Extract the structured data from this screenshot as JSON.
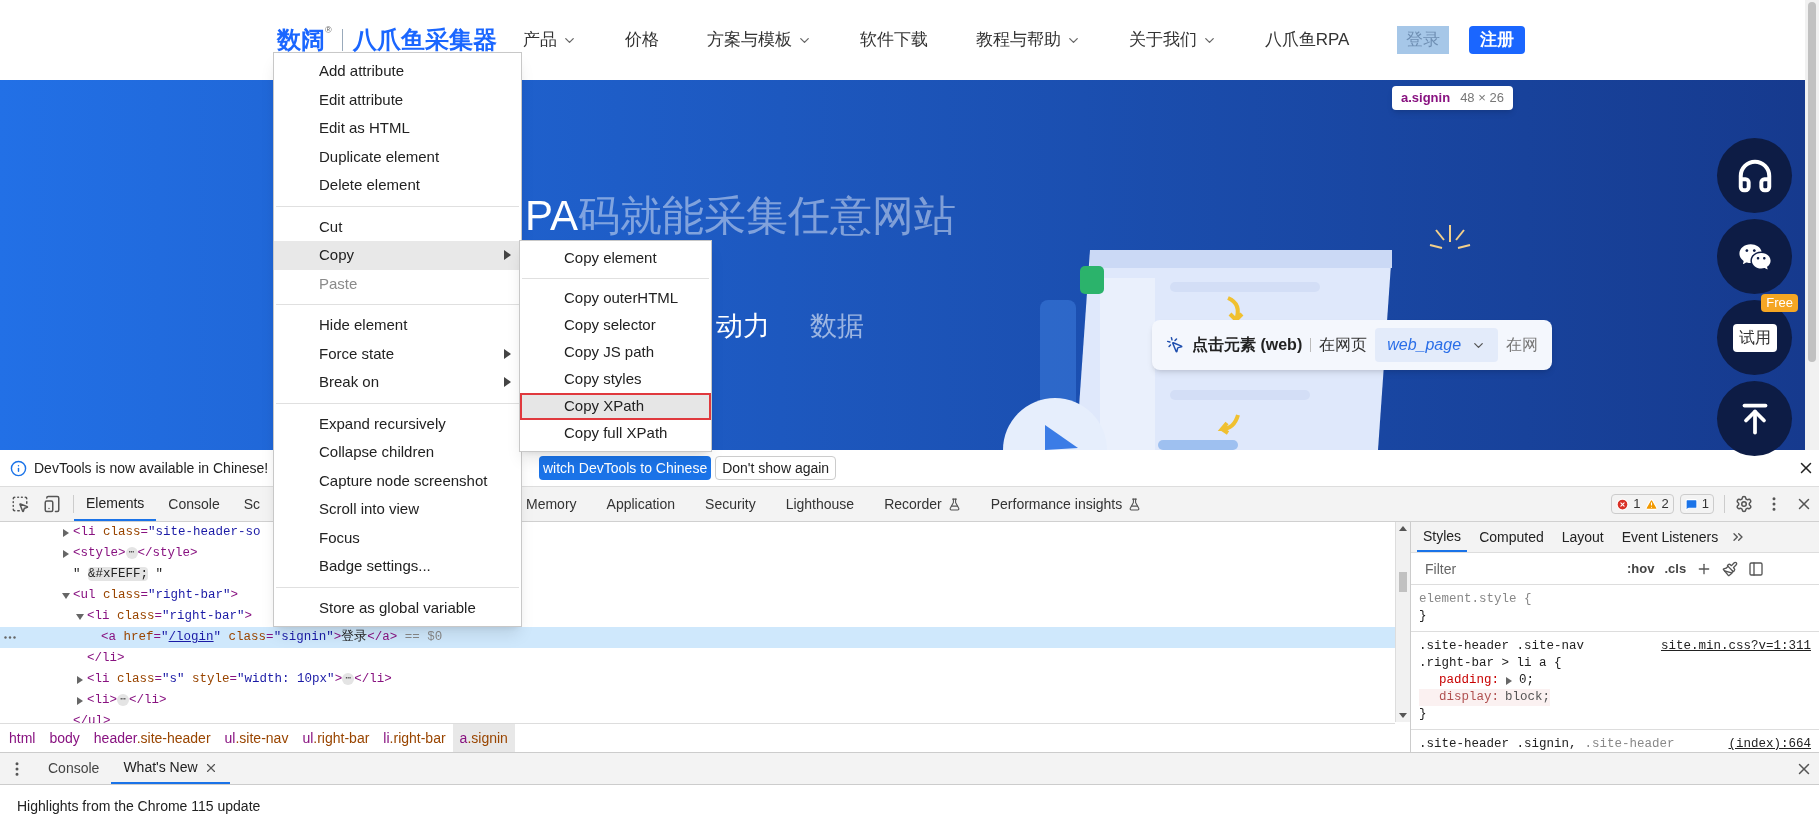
{
  "site_header": {
    "logo": {
      "brand": "数阔",
      "mark": "®",
      "product": "八爪鱼采集器"
    },
    "nav": [
      {
        "label": "产品",
        "dropdown": true
      },
      {
        "label": "价格",
        "dropdown": false
      },
      {
        "label": "方案与模板",
        "dropdown": true
      },
      {
        "label": "软件下载",
        "dropdown": false
      },
      {
        "label": "教程与帮助",
        "dropdown": true
      },
      {
        "label": "关于我们",
        "dropdown": true
      },
      {
        "label": "八爪鱼RPA",
        "dropdown": false
      }
    ],
    "login": {
      "label": "登录",
      "highlighted": true
    },
    "register": {
      "label": "注册"
    }
  },
  "inspect_tooltip": {
    "selector": "a.signin",
    "size": "48 × 26"
  },
  "hero": {
    "title_lead": "PA",
    "title_rest": "码就能采集任意网站",
    "subtitle_lead": "动力",
    "subtitle_rest": "数据",
    "demo_card": {
      "action": "点击元素 (web)",
      "label": "在网页",
      "value": "web_page",
      "trailing": "在网"
    }
  },
  "float_buttons": [
    {
      "kind": "support"
    },
    {
      "kind": "wechat"
    },
    {
      "kind": "trial",
      "label": "试用",
      "badge": "Free"
    },
    {
      "kind": "top"
    }
  ],
  "context_menu": {
    "groups": [
      [
        {
          "label": "Add attribute",
          "disabled": false,
          "selected": false,
          "submenu": false
        },
        {
          "label": "Edit attribute",
          "disabled": false,
          "selected": false,
          "submenu": false
        },
        {
          "label": "Edit as HTML",
          "disabled": false,
          "selected": false,
          "submenu": false
        },
        {
          "label": "Duplicate element",
          "disabled": false,
          "selected": false,
          "submenu": false
        },
        {
          "label": "Delete element",
          "disabled": false,
          "selected": false,
          "submenu": false
        }
      ],
      [
        {
          "label": "Cut",
          "disabled": false,
          "selected": false,
          "submenu": false
        },
        {
          "label": "Copy",
          "disabled": false,
          "selected": true,
          "submenu": true
        },
        {
          "label": "Paste",
          "disabled": true,
          "selected": false,
          "submenu": false
        }
      ],
      [
        {
          "label": "Hide element",
          "disabled": false,
          "selected": false,
          "submenu": false
        },
        {
          "label": "Force state",
          "disabled": false,
          "selected": false,
          "submenu": true
        },
        {
          "label": "Break on",
          "disabled": false,
          "selected": false,
          "submenu": true
        }
      ],
      [
        {
          "label": "Expand recursively",
          "disabled": false,
          "selected": false,
          "submenu": false
        },
        {
          "label": "Collapse children",
          "disabled": false,
          "selected": false,
          "submenu": false
        },
        {
          "label": "Capture node screenshot",
          "disabled": false,
          "selected": false,
          "submenu": false
        },
        {
          "label": "Scroll into view",
          "disabled": false,
          "selected": false,
          "submenu": false
        },
        {
          "label": "Focus",
          "disabled": false,
          "selected": false,
          "submenu": false
        },
        {
          "label": "Badge settings...",
          "disabled": false,
          "selected": false,
          "submenu": false
        }
      ],
      [
        {
          "label": "Store as global variable",
          "disabled": false,
          "selected": false,
          "submenu": false
        }
      ]
    ]
  },
  "copy_submenu": {
    "groups": [
      [
        {
          "label": "Copy element",
          "selected": false
        }
      ],
      [
        {
          "label": "Copy outerHTML",
          "selected": false
        },
        {
          "label": "Copy selector",
          "selected": false
        },
        {
          "label": "Copy JS path",
          "selected": false
        },
        {
          "label": "Copy styles",
          "selected": false
        },
        {
          "label": "Copy XPath",
          "selected": true
        },
        {
          "label": "Copy full XPath",
          "selected": false
        }
      ]
    ]
  },
  "devtools": {
    "infobar": {
      "message": "DevTools is now available in Chinese!",
      "switch_button": "witch DevTools to Chinese",
      "dismiss_button": "Don't show again"
    },
    "tabs_left": [
      {
        "label": "Elements",
        "selected": true
      },
      {
        "label": "Console",
        "selected": false
      },
      {
        "label": "Sc",
        "selected": false
      }
    ],
    "tabs_right": [
      {
        "label": "Memory",
        "selected": false,
        "experimental": false
      },
      {
        "label": "Application",
        "selected": false,
        "experimental": false
      },
      {
        "label": "Security",
        "selected": false,
        "experimental": false
      },
      {
        "label": "Lighthouse",
        "selected": false,
        "experimental": false
      },
      {
        "label": "Recorder",
        "selected": false,
        "experimental": true
      },
      {
        "label": "Performance insights",
        "selected": false,
        "experimental": true
      }
    ],
    "counts": {
      "errors": "1",
      "warnings": "2",
      "messages": "1"
    },
    "dom_tree": [
      {
        "kind": "collapsible",
        "expanded": false,
        "selected": false,
        "open": [
          {
            "kind": "tag",
            "text": "<li "
          },
          {
            "kind": "attr",
            "text": "class"
          },
          {
            "kind": "tag",
            "text": "="
          },
          {
            "kind": "value",
            "text": "\"site-header-so"
          }
        ]
      },
      {
        "kind": "collapsible",
        "expanded": false,
        "selected": false,
        "open": [
          {
            "kind": "tag",
            "text": "<style>"
          },
          {
            "kind": "ellipsis",
            "text": "⋯"
          },
          {
            "kind": "tag",
            "text": "</style>"
          }
        ]
      },
      {
        "kind": "leaf",
        "selected": false,
        "open": [
          {
            "kind": "text",
            "text": "\" "
          },
          {
            "kind": "entity",
            "text": "&#xFEFF;"
          },
          {
            "kind": "text",
            "text": " \""
          }
        ]
      },
      {
        "kind": "collapsible",
        "expanded": true,
        "selected": false,
        "open": [
          {
            "kind": "tag",
            "text": "<ul "
          },
          {
            "kind": "attr",
            "text": "class"
          },
          {
            "kind": "tag",
            "text": "="
          },
          {
            "kind": "value",
            "text": "\"right-bar\""
          },
          {
            "kind": "tag",
            "text": ">"
          }
        ],
        "close": [
          {
            "kind": "tag",
            "text": "</ul>"
          }
        ],
        "children": [
          {
            "kind": "collapsible",
            "expanded": true,
            "selected": false,
            "open": [
              {
                "kind": "tag",
                "text": "<li "
              },
              {
                "kind": "attr",
                "text": "class"
              },
              {
                "kind": "tag",
                "text": "="
              },
              {
                "kind": "value",
                "text": "\"right-bar\""
              },
              {
                "kind": "tag",
                "text": ">"
              }
            ],
            "close": [
              {
                "kind": "tag",
                "text": "</li>"
              }
            ],
            "children": [
              {
                "kind": "leaf",
                "selected": true,
                "open": [
                  {
                    "kind": "tag",
                    "text": "<a "
                  },
                  {
                    "kind": "attr",
                    "text": "href"
                  },
                  {
                    "kind": "tag",
                    "text": "="
                  },
                  {
                    "kind": "value",
                    "text": "\""
                  },
                  {
                    "kind": "link",
                    "text": "/login"
                  },
                  {
                    "kind": "value",
                    "text": "\""
                  },
                  {
                    "kind": "attr",
                    "text": " class"
                  },
                  {
                    "kind": "tag",
                    "text": "="
                  },
                  {
                    "kind": "value",
                    "text": "\"signin\""
                  },
                  {
                    "kind": "tag",
                    "text": ">"
                  },
                  {
                    "kind": "text",
                    "text": "登录"
                  },
                  {
                    "kind": "tag",
                    "text": "</a>"
                  },
                  {
                    "kind": "dim",
                    "text": " == $0"
                  }
                ]
              }
            ]
          },
          {
            "kind": "collapsible",
            "expanded": false,
            "selected": false,
            "open": [
              {
                "kind": "tag",
                "text": "<li "
              },
              {
                "kind": "attr",
                "text": "class"
              },
              {
                "kind": "tag",
                "text": "="
              },
              {
                "kind": "value",
                "text": "\"s\""
              },
              {
                "kind": "attr",
                "text": " style"
              },
              {
                "kind": "tag",
                "text": "="
              },
              {
                "kind": "value",
                "text": "\"width: 10px\""
              },
              {
                "kind": "tag",
                "text": ">"
              },
              {
                "kind": "ellipsis",
                "text": "⋯"
              },
              {
                "kind": "tag",
                "text": "</li>"
              }
            ]
          },
          {
            "kind": "collapsible",
            "expanded": false,
            "selected": false,
            "open": [
              {
                "kind": "tag",
                "text": "<li>"
              },
              {
                "kind": "ellipsis",
                "text": "⋯"
              },
              {
                "kind": "tag",
                "text": "</li>"
              }
            ]
          }
        ]
      }
    ],
    "breadcrumbs": [
      {
        "tag": "html",
        "selected": false
      },
      {
        "tag": "body",
        "selected": false
      },
      {
        "tag": "header",
        "cls": ".site-header",
        "selected": false
      },
      {
        "tag": "ul",
        "cls": ".site-nav",
        "selected": false
      },
      {
        "tag": "ul",
        "cls": ".right-bar",
        "selected": false
      },
      {
        "tag": "li",
        "cls": ".right-bar",
        "selected": false
      },
      {
        "tag": "a",
        "cls": ".signin",
        "selected": true
      }
    ],
    "styles_tabs": [
      {
        "label": "Styles",
        "selected": true
      },
      {
        "label": "Computed",
        "selected": false
      },
      {
        "label": "Layout",
        "selected": false
      },
      {
        "label": "Event Listeners",
        "selected": false
      }
    ],
    "filter": {
      "placeholder": "Filter"
    },
    "style_toggles": [
      ":hov",
      ".cls"
    ],
    "rules": [
      {
        "selector_lines": [
          [
            {
              "text": "element.style {",
              "matched": false
            }
          ]
        ],
        "close": "}"
      },
      {
        "selector_lines": [
          [
            {
              "text": ".site-header .site-nav",
              "matched": true
            }
          ],
          [
            {
              "text": ".right-bar > li a {",
              "matched": true
            }
          ]
        ],
        "source": "site.min.css?v=1:311",
        "declarations": [
          {
            "name": "padding:",
            "value": "0;",
            "expandable": true,
            "overridden": false
          },
          {
            "name": "display:",
            "value": "block;",
            "expandable": false,
            "overridden": true
          }
        ],
        "close": "}"
      },
      {
        "selector_lines": [
          [
            {
              "text": ".site-header .signin,",
              "matched": true
            },
            {
              "text": ".site-header",
              "matched": false
            }
          ]
        ],
        "source": "(index):664"
      }
    ],
    "drawer_tabs": [
      {
        "label": "Console",
        "selected": false,
        "closable": false
      },
      {
        "label": "What's New",
        "selected": true,
        "closable": true
      }
    ],
    "drawer_text": "Highlights from the Chrome 115 update"
  }
}
